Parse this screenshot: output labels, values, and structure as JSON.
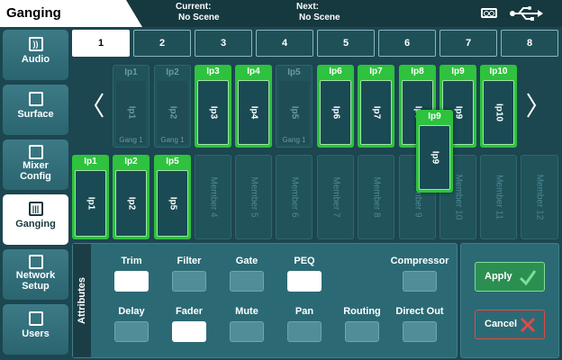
{
  "header": {
    "title": "Ganging",
    "current_label": "Current:",
    "current_value": "No Scene",
    "next_label": "Next:",
    "next_value": "No Scene",
    "icons": [
      "tape-icon",
      "usb-icon"
    ]
  },
  "sidebar": {
    "items": [
      {
        "label": "Audio",
        "icon": "audio-icon"
      },
      {
        "label": "Surface",
        "icon": "surface-icon"
      },
      {
        "label": "Mixer Config",
        "icon": "mixer-config-icon"
      },
      {
        "label": "Ganging",
        "icon": "ganging-icon",
        "active": true
      },
      {
        "label": "Network Setup",
        "icon": "network-icon"
      },
      {
        "label": "Users",
        "icon": "users-icon"
      }
    ]
  },
  "gang_tabs": [
    "1",
    "2",
    "3",
    "4",
    "5",
    "6",
    "7",
    "8"
  ],
  "selected_gang": "1",
  "channels": [
    {
      "name": "Ip1",
      "state": "dim",
      "sub": "Gang 1"
    },
    {
      "name": "Ip2",
      "state": "dim",
      "sub": "Gang 1"
    },
    {
      "name": "Ip3",
      "state": "green",
      "sub": ""
    },
    {
      "name": "Ip4",
      "state": "green",
      "sub": ""
    },
    {
      "name": "Ip5",
      "state": "dim",
      "sub": "Gang 1"
    },
    {
      "name": "Ip6",
      "state": "green",
      "sub": ""
    },
    {
      "name": "Ip7",
      "state": "green",
      "sub": ""
    },
    {
      "name": "Ip8",
      "state": "green",
      "sub": ""
    },
    {
      "name": "Ip9",
      "state": "green",
      "sub": ""
    },
    {
      "name": "Ip10",
      "state": "green",
      "sub": ""
    }
  ],
  "dragging": {
    "name": "Ip9"
  },
  "members": [
    {
      "name": "Ip1",
      "filled": true
    },
    {
      "name": "Ip2",
      "filled": true
    },
    {
      "name": "Ip5",
      "filled": true
    },
    {
      "name": "Member 4",
      "filled": false
    },
    {
      "name": "Member 5",
      "filled": false
    },
    {
      "name": "Member 6",
      "filled": false
    },
    {
      "name": "Member 7",
      "filled": false
    },
    {
      "name": "Member 8",
      "filled": false
    },
    {
      "name": "Member 9",
      "filled": false
    },
    {
      "name": "Member 10",
      "filled": false
    },
    {
      "name": "Member 11",
      "filled": false
    },
    {
      "name": "Member 12",
      "filled": false
    }
  ],
  "attributes": {
    "heading": "Attributes",
    "row1": [
      {
        "label": "Trim",
        "on": true
      },
      {
        "label": "Filter",
        "on": false
      },
      {
        "label": "Gate",
        "on": false
      },
      {
        "label": "PEQ",
        "on": true
      },
      {
        "label": "Compressor",
        "on": false
      }
    ],
    "row2": [
      {
        "label": "Delay",
        "on": false
      },
      {
        "label": "Fader",
        "on": true
      },
      {
        "label": "Mute",
        "on": false
      },
      {
        "label": "Pan",
        "on": false
      },
      {
        "label": "Routing",
        "on": false
      },
      {
        "label": "Direct Out",
        "on": false
      }
    ]
  },
  "actions": {
    "apply_label": "Apply",
    "cancel_label": "Cancel"
  },
  "colors": {
    "background": "#1c4650",
    "active_green": "#2ec23e",
    "apply_green": "#2c8f52",
    "cancel_red": "#e04a4a"
  }
}
